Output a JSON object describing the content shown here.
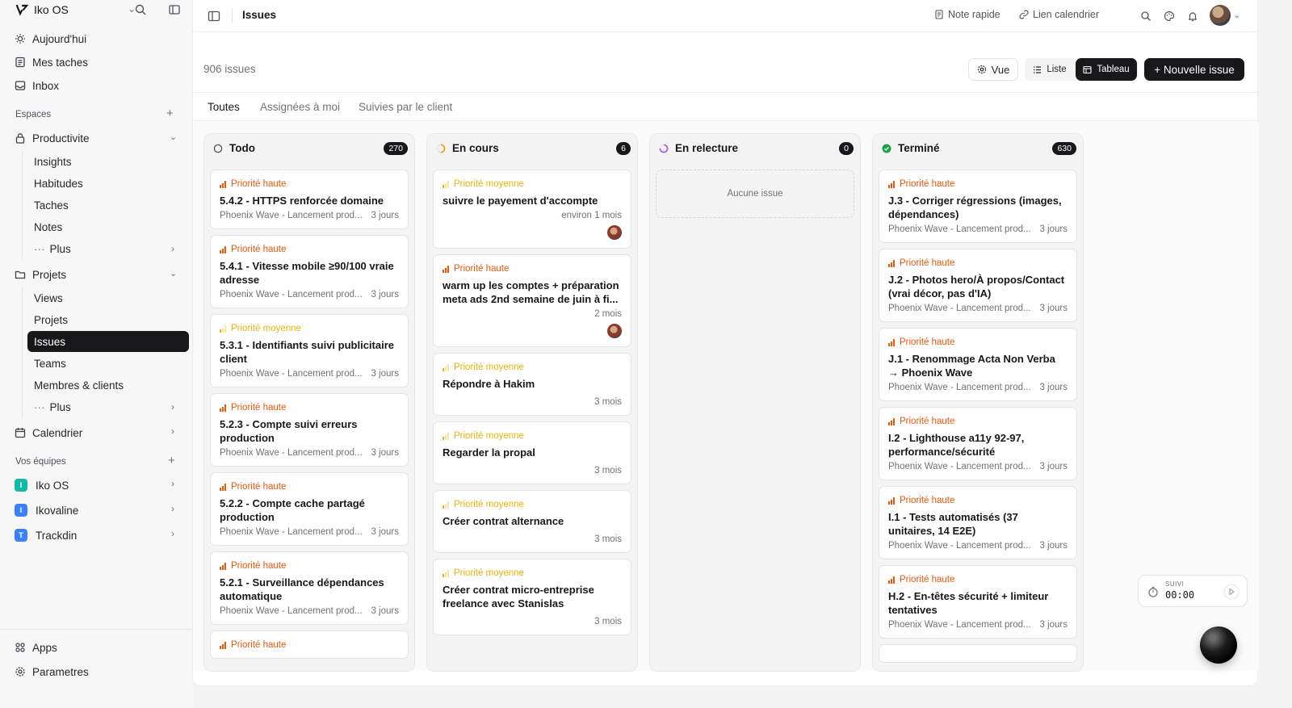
{
  "workspace": {
    "name": "Iko OS"
  },
  "sidebar": {
    "top_items": [
      {
        "label": "Aujourd'hui",
        "icon": "sun-icon"
      },
      {
        "label": "Mes taches",
        "icon": "checklist-icon"
      },
      {
        "label": "Inbox",
        "icon": "inbox-icon"
      }
    ],
    "spaces_label": "Espaces",
    "productivite": {
      "label": "Productivite",
      "items": [
        "Insights",
        "Habitudes",
        "Taches",
        "Notes"
      ],
      "more": "Plus"
    },
    "projets": {
      "label": "Projets",
      "items": [
        "Views",
        "Projets",
        "Issues",
        "Teams",
        "Membres & clients"
      ],
      "active": "Issues",
      "more": "Plus"
    },
    "calendar": {
      "label": "Calendrier"
    },
    "teams_label": "Vos équipes",
    "teams": [
      {
        "name": "Iko OS",
        "initial": "I",
        "color": "#14b8a6"
      },
      {
        "name": "Ikovaline",
        "initial": "I",
        "color": "#3b82f6"
      },
      {
        "name": "Trackdin",
        "initial": "T",
        "color": "#3b82f6"
      }
    ],
    "bottom": {
      "apps": "Apps",
      "settings": "Parametres"
    }
  },
  "topbar": {
    "title": "Issues",
    "quick_note": "Note rapide",
    "calendar_link": "Lien calendrier"
  },
  "toolbar": {
    "count": "906 issues",
    "vue": "Vue",
    "liste": "Liste",
    "tableau": "Tableau",
    "new_issue": "+ Nouvelle issue"
  },
  "tabs": [
    "Toutes",
    "Assignées à moi",
    "Suivies par le client"
  ],
  "columns": [
    {
      "title": "Todo",
      "count": "270",
      "status_color": "#71717a",
      "cards": [
        {
          "priority": "Priorité haute",
          "level": "haute",
          "title": "5.4.2 - HTTPS renforcée domaine",
          "project": "Phoenix Wave - Lancement prod...",
          "age": "3 jours"
        },
        {
          "priority": "Priorité haute",
          "level": "haute",
          "title": "5.4.1 - Vitesse mobile ≥90/100 vraie adresse",
          "project": "Phoenix Wave - Lancement prod...",
          "age": "3 jours"
        },
        {
          "priority": "Priorité moyenne",
          "level": "moyenne",
          "title": "5.3.1 - Identifiants suivi publicitaire client",
          "project": "Phoenix Wave - Lancement prod...",
          "age": "3 jours"
        },
        {
          "priority": "Priorité haute",
          "level": "haute",
          "title": "5.2.3 - Compte suivi erreurs production",
          "project": "Phoenix Wave - Lancement prod...",
          "age": "3 jours"
        },
        {
          "priority": "Priorité haute",
          "level": "haute",
          "title": "5.2.2 - Compte cache partagé production",
          "project": "Phoenix Wave - Lancement prod...",
          "age": "3 jours"
        },
        {
          "priority": "Priorité haute",
          "level": "haute",
          "title": "5.2.1 - Surveillance dépendances automatique",
          "project": "Phoenix Wave - Lancement prod...",
          "age": "3 jours"
        },
        {
          "priority": "Priorité haute",
          "level": "haute",
          "title": "",
          "project": "",
          "age": ""
        }
      ]
    },
    {
      "title": "En cours",
      "count": "6",
      "status_color": "#f59e0b",
      "cards": [
        {
          "priority": "Priorité moyenne",
          "level": "moyenne",
          "title": "suivre le payement d'accompte",
          "time": "environ 1 mois",
          "avatar": true
        },
        {
          "priority": "Priorité haute",
          "level": "haute",
          "title": "warm up les comptes + préparation meta ads 2nd semaine de juin à fi...",
          "time": "2 mois",
          "avatar": true
        },
        {
          "priority": "Priorité moyenne",
          "level": "moyenne",
          "title": "Répondre à Hakim",
          "time": "3 mois"
        },
        {
          "priority": "Priorité moyenne",
          "level": "moyenne",
          "title": "Regarder la propal",
          "time": "3 mois"
        },
        {
          "priority": "Priorité moyenne",
          "level": "moyenne",
          "title": "Créer contrat alternance",
          "time": "3 mois"
        },
        {
          "priority": "Priorité moyenne",
          "level": "moyenne",
          "title": "Créer contrat micro-entreprise freelance avec Stanislas",
          "time": "3 mois"
        }
      ]
    },
    {
      "title": "En relecture",
      "count": "0",
      "status_color": "#a855f7",
      "empty": "Aucune issue"
    },
    {
      "title": "Terminé",
      "count": "630",
      "status_color": "#16a34a",
      "cards": [
        {
          "priority": "Priorité haute",
          "level": "haute",
          "title": "J.3 - Corriger régressions (images, dépendances)",
          "project": "Phoenix Wave - Lancement prod...",
          "age": "3 jours"
        },
        {
          "priority": "Priorité haute",
          "level": "haute",
          "title": "J.2 - Photos hero/À propos/Contact (vrai décor, pas d'IA)",
          "project": "Phoenix Wave - Lancement prod...",
          "age": "3 jours"
        },
        {
          "priority": "Priorité haute",
          "level": "haute",
          "title": "J.1 - Renommage Acta Non Verba → Phoenix Wave",
          "project": "Phoenix Wave - Lancement prod...",
          "age": "3 jours"
        },
        {
          "priority": "Priorité haute",
          "level": "haute",
          "title": "I.2 - Lighthouse a11y 92-97, performance/sécurité",
          "project": "Phoenix Wave - Lancement prod...",
          "age": "3 jours"
        },
        {
          "priority": "Priorité haute",
          "level": "haute",
          "title": "I.1 - Tests automatisés (37 unitaires, 14 E2E)",
          "project": "Phoenix Wave - Lancement prod...",
          "age": "3 jours"
        },
        {
          "priority": "Priorité haute",
          "level": "haute",
          "title": "H.2 - En-têtes sécurité + limiteur tentatives",
          "project": "Phoenix Wave - Lancement prod...",
          "age": "3 jours"
        },
        {
          "priority": "",
          "level": "haute",
          "title": "",
          "project": "",
          "age": ""
        }
      ]
    }
  ],
  "timer": {
    "label": "SUIVI",
    "value": "00:00"
  }
}
